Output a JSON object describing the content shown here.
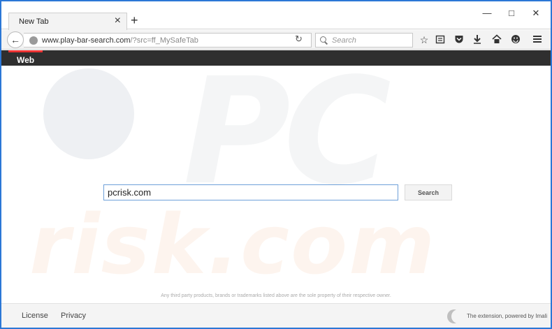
{
  "browser": {
    "tab_title": "New Tab",
    "tab_close": "×",
    "new_tab": "+",
    "window_controls": {
      "minimize": "—",
      "maximize": "□",
      "close": "✕"
    },
    "url_host": "www.play-bar-search.com",
    "url_path": "/?src=ff_MySafeTab",
    "search_placeholder": "Search",
    "toolbar_icons": [
      "star-icon",
      "reading-list-icon",
      "pocket-icon",
      "download-icon",
      "home-icon",
      "smiley-icon",
      "hamburger-menu-icon"
    ]
  },
  "webbar": {
    "label": "Web"
  },
  "main": {
    "search_value": "pcrisk.com",
    "search_button": "Search",
    "disclaimer": "Any third party products, brands or trademarks listed above are the sole property of their respective owner."
  },
  "footer": {
    "license": "License",
    "privacy": "Privacy",
    "powered_by": "The extension, powered by Imali"
  },
  "watermark": {
    "top": "PC",
    "bottom": "risk.com"
  },
  "colors": {
    "frame": "#2b77d6",
    "menubar": "#2f2f2f",
    "accent": "#e33333"
  }
}
